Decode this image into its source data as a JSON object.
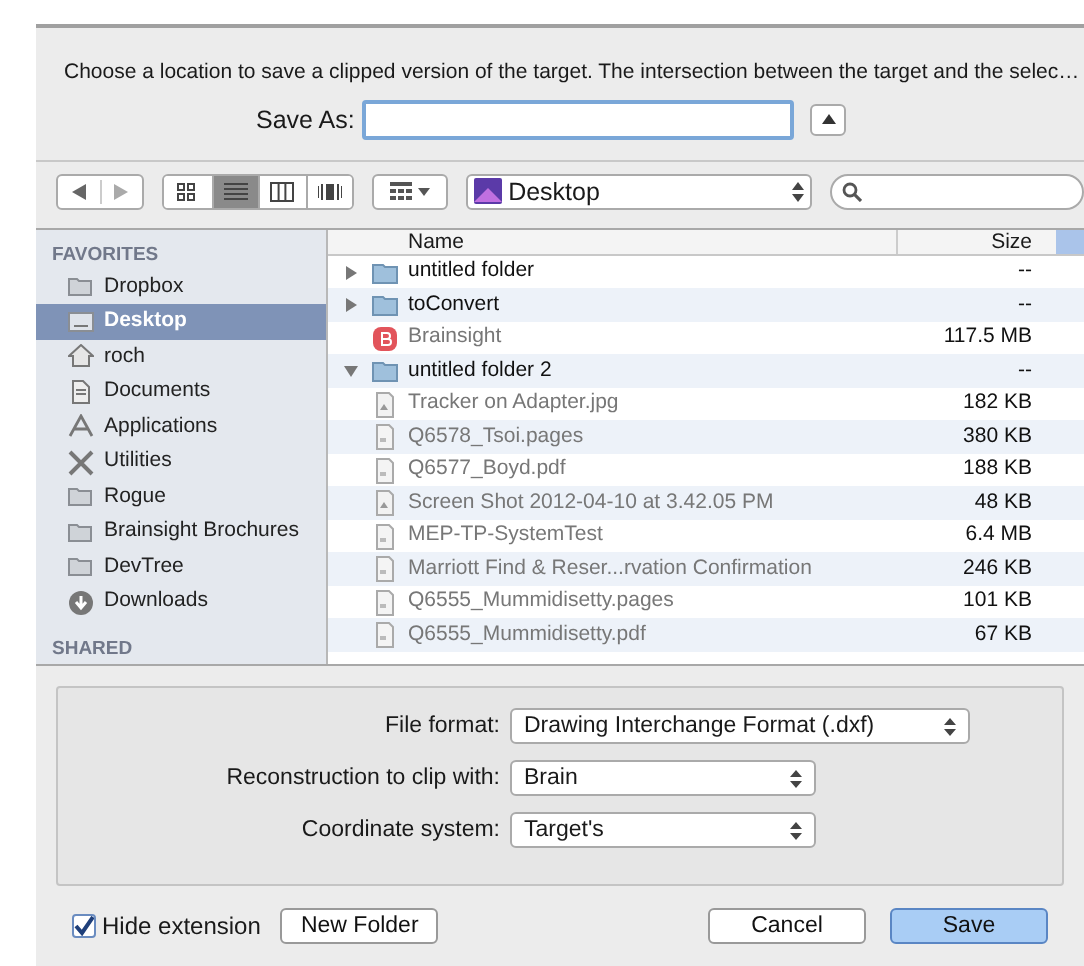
{
  "message": "Choose a location to save a clipped version of the target. The intersection between the target and the selec…",
  "save_as": {
    "label": "Save As:"
  },
  "toolbar": {
    "location": "Desktop",
    "view_modes": [
      {
        "kind": "icons",
        "selected": false
      },
      {
        "kind": "list",
        "selected": true
      },
      {
        "kind": "columns",
        "selected": false
      },
      {
        "kind": "coverflow",
        "selected": false
      }
    ]
  },
  "sidebar": {
    "sections": [
      {
        "title": "FAVORITES",
        "items": [
          {
            "label": "Dropbox",
            "kind": "folder",
            "selected": false
          },
          {
            "label": "Desktop",
            "kind": "desktop",
            "selected": true
          },
          {
            "label": "roch",
            "kind": "home",
            "selected": false
          },
          {
            "label": "Documents",
            "kind": "documents",
            "selected": false
          },
          {
            "label": "Applications",
            "kind": "applications",
            "selected": false
          },
          {
            "label": "Utilities",
            "kind": "utilities",
            "selected": false
          },
          {
            "label": "Rogue",
            "kind": "folder",
            "selected": false
          },
          {
            "label": "Brainsight Brochures",
            "kind": "folder",
            "selected": false
          },
          {
            "label": "DevTree",
            "kind": "folder",
            "selected": false
          },
          {
            "label": "Downloads",
            "kind": "downloads",
            "selected": false
          }
        ]
      },
      {
        "title": "SHARED"
      }
    ]
  },
  "file_list": {
    "columns": [
      "Name",
      "Size"
    ],
    "rows": [
      {
        "name": "untitled folder",
        "size": "--",
        "kind": "folder",
        "expanded": false
      },
      {
        "name": "toConvert",
        "size": "--",
        "kind": "folder",
        "expanded": false
      },
      {
        "name": "Brainsight",
        "size": "117.5 MB",
        "kind": "app"
      },
      {
        "name": "untitled folder 2",
        "size": "--",
        "kind": "folder",
        "expanded": true,
        "children": [
          {
            "name": "Tracker on Adapter.jpg",
            "size": "182 KB",
            "kind": "image"
          },
          {
            "name": "Q6578_Tsoi.pages",
            "size": "380 KB",
            "kind": "document"
          },
          {
            "name": "Q6577_Boyd.pdf",
            "size": "188 KB",
            "kind": "document"
          },
          {
            "name": "Screen Shot 2012-04-10 at 3.42.05 PM",
            "size": "48 KB",
            "kind": "image"
          },
          {
            "name": "MEP-TP-SystemTest",
            "size": "6.4 MB",
            "kind": "document"
          },
          {
            "name": "Marriott Find & Reser...rvation Confirmation",
            "size": "246 KB",
            "kind": "document"
          },
          {
            "name": "Q6555_Mummidisetty.pages",
            "size": "101 KB",
            "kind": "document"
          },
          {
            "name": "Q6555_Mummidisetty.pdf",
            "size": "67 KB",
            "kind": "document"
          }
        ]
      }
    ]
  },
  "options": [
    {
      "label": "File format:",
      "value": "Drawing Interchange Format (.dxf)"
    },
    {
      "label": "Reconstruction to clip with:",
      "value": "Brain"
    },
    {
      "label": "Coordinate system:",
      "value": "Target's"
    }
  ],
  "hide_extension": {
    "label": "Hide extension",
    "checked": true
  },
  "buttons": [
    {
      "label": "New Folder",
      "kind": "secondary"
    },
    {
      "label": "Cancel",
      "kind": "secondary"
    },
    {
      "label": "Save",
      "kind": "default"
    }
  ]
}
